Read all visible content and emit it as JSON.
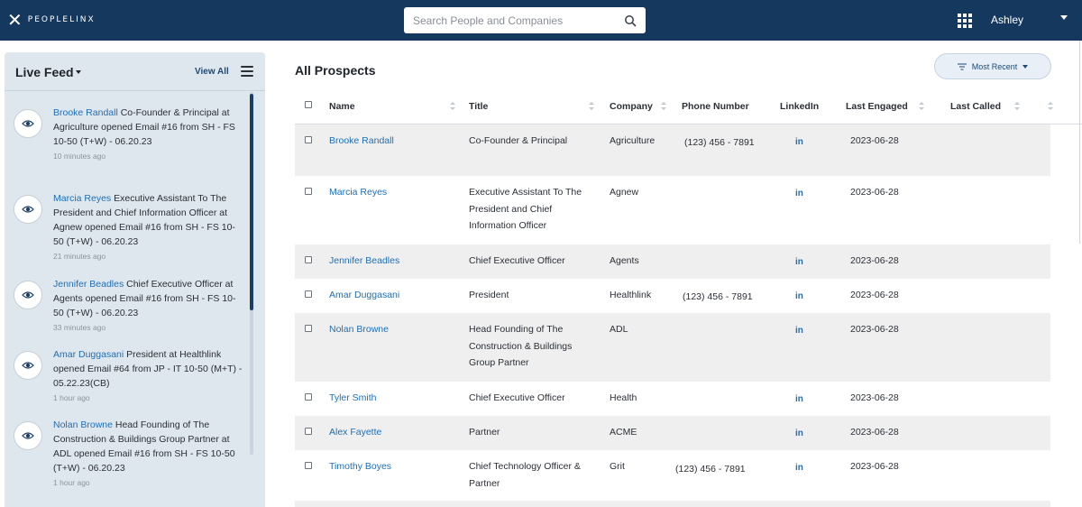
{
  "header": {
    "logo_mark": "✕",
    "logo_text": "PEOPLELINX",
    "search_placeholder": "Search People and Companies",
    "user_name": "Ashley",
    "icons": {
      "search": "search-icon",
      "apps": "grid-icon",
      "caret": "chevron-down-icon"
    }
  },
  "sidebar": {
    "title": "Live Feed",
    "view_all": "View All",
    "items": [
      {
        "name": "Brooke Randall",
        "text": " Co-Founder & Principal at Agriculture opened Email #16 from SH - FS 10-50 (T+W) - 06.20.23",
        "time": "10 minutes ago"
      },
      {
        "name": "Marcia Reyes",
        "text": " Executive Assistant To The President and Chief Information Officer at Agnew opened Email #16 from SH - FS 10-50 (T+W) - 06.20.23",
        "time": "21 minutes ago"
      },
      {
        "name": "Jennifer Beadles",
        "text": " Chief Executive Officer at Agents opened Email #16 from SH - FS 10-50 (T+W) - 06.20.23",
        "time": "33 minutes ago"
      },
      {
        "name": "Amar Duggasani",
        "text": " President at Healthlink opened Email #64 from JP - IT 10-50 (M+T) - 05.22.23(CB)",
        "time": "1 hour ago"
      },
      {
        "name": "Nolan Browne",
        "text": " Head Founding of The Construction & Buildings Group Partner at ADL opened Email #16 from SH - FS 10-50 (T+W) - 06.20.23",
        "time": "1 hour ago"
      }
    ]
  },
  "main": {
    "title": "All Prospects",
    "sort_label": "Most Recent",
    "columns": [
      "Name",
      "Title",
      "Company",
      "Phone Number",
      "LinkedIn",
      "Last Engaged",
      "Last Called"
    ],
    "rows": [
      {
        "name": "Brooke Randall",
        "title": "Co-Founder & Principal",
        "company": "Agriculture",
        "phone": "(123) 456 - 7891",
        "linkedin": "in",
        "last_engaged": "2023-06-28",
        "last_called": ""
      },
      {
        "name": "Marcia Reyes",
        "title": "Executive Assistant To The President and Chief Information Officer",
        "company": "Agnew",
        "phone": "",
        "linkedin": "in",
        "last_engaged": "2023-06-28",
        "last_called": ""
      },
      {
        "name": "Jennifer Beadles",
        "title": "Chief Executive Officer",
        "company": "Agents",
        "phone": "",
        "linkedin": "in",
        "last_engaged": "2023-06-28",
        "last_called": ""
      },
      {
        "name": "Amar Duggasani",
        "title": "President",
        "company": "Healthlink",
        "phone": "(123) 456 - 7891",
        "linkedin": "in",
        "last_engaged": "2023-06-28",
        "last_called": ""
      },
      {
        "name": "Nolan Browne",
        "title": "Head Founding of The Construction & Buildings Group Partner",
        "company": "ADL",
        "phone": "",
        "linkedin": "in",
        "last_engaged": "2023-06-28",
        "last_called": ""
      },
      {
        "name": "Tyler Smith",
        "title": "Chief Executive Officer",
        "company": "Health",
        "phone": "",
        "linkedin": "in",
        "last_engaged": "2023-06-28",
        "last_called": ""
      },
      {
        "name": "Alex Fayette",
        "title": "Partner",
        "company": "ACME",
        "phone": "",
        "linkedin": "in",
        "last_engaged": "2023-06-28",
        "last_called": ""
      },
      {
        "name": "Timothy Boyes",
        "title": "Chief Technology Officer & Partner",
        "company": "Grit",
        "phone": "(123) 456 - 7891",
        "linkedin": "in",
        "last_engaged": "2023-06-28",
        "last_called": ""
      }
    ]
  },
  "colors": {
    "topbar": "#15385e",
    "link": "#1d6fb8",
    "sidebar_bg": "#dfe7ee",
    "row_shade": "#efefef"
  }
}
